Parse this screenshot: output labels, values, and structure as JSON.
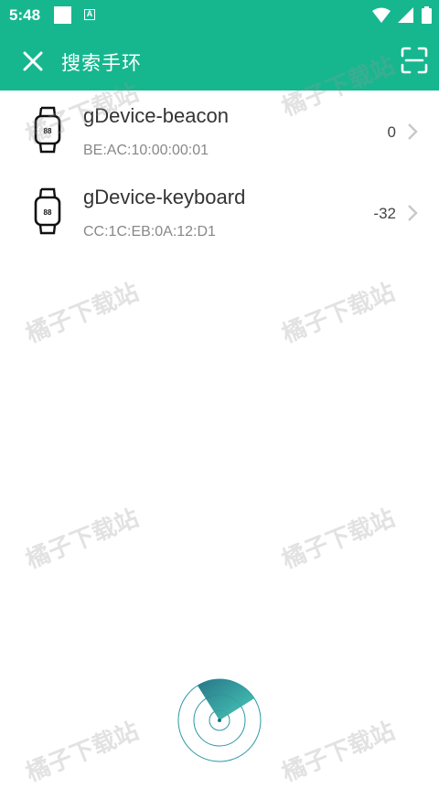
{
  "status_bar": {
    "time": "5:48",
    "notification_icons": [
      "white-square-icon",
      "a-box-icon"
    ],
    "right_icons": [
      "wifi-icon",
      "signal-icon",
      "battery-icon"
    ]
  },
  "app_bar": {
    "title": "搜索手环",
    "close_icon": "close-icon",
    "scan_icon": "scan-icon",
    "background": "#16b78f"
  },
  "devices": [
    {
      "name": "gDevice-beacon",
      "mac": "BE:AC:10:00:00:01",
      "rssi": "0"
    },
    {
      "name": "gDevice-keyboard",
      "mac": "CC:1C:EB:0A:12:D1",
      "rssi": "-32"
    }
  ],
  "watermark": "橘子下载站",
  "radar_icon": "radar-scan-icon"
}
